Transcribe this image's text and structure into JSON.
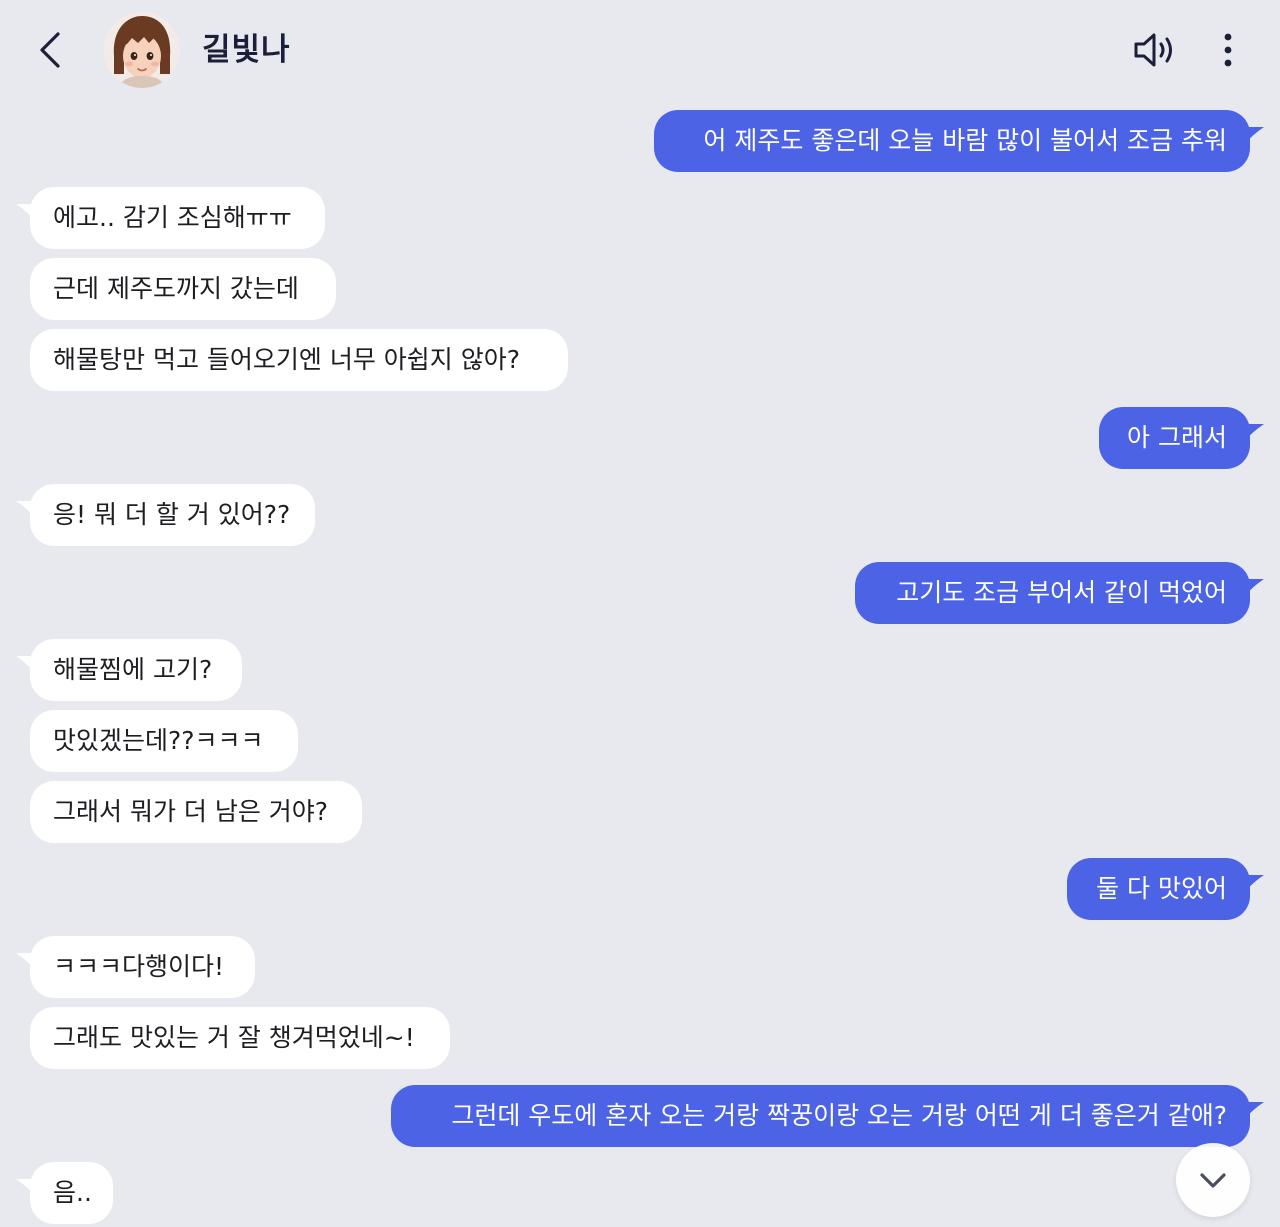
{
  "header": {
    "contact_name": "길빛나"
  },
  "colors": {
    "background": "#e8e9ee",
    "sent_bubble": "#4c63e6",
    "received_bubble": "#ffffff",
    "name_text": "#1c1f3a"
  },
  "icons": {
    "back": "chevron-left-icon",
    "speaker": "speaker-volume-icon",
    "more": "vertical-dots-icon",
    "scroll": "chevron-down-icon"
  },
  "messages": [
    {
      "side": "sent",
      "text": "어 제주도 좋은데 오늘 바람 많이 불어서 조금 추워"
    },
    {
      "side": "received",
      "text": "에고.. 감기 조심해ㅠㅠ"
    },
    {
      "side": "received",
      "text": "근데 제주도까지 갔는데"
    },
    {
      "side": "received",
      "text": "해물탕만 먹고 들어오기엔 너무 아쉽지 않아?"
    },
    {
      "side": "sent",
      "text": "아 그래서"
    },
    {
      "side": "received",
      "text": "응! 뭐 더 할 거 있어??"
    },
    {
      "side": "sent",
      "text": "고기도 조금 부어서 같이 먹었어"
    },
    {
      "side": "received",
      "text": "해물찜에 고기?"
    },
    {
      "side": "received",
      "text": "맛있겠는데??ㅋㅋㅋ"
    },
    {
      "side": "received",
      "text": "그래서 뭐가 더 남은 거야?"
    },
    {
      "side": "sent",
      "text": "둘 다 맛있어"
    },
    {
      "side": "received",
      "text": "ㅋㅋㅋ다행이다!"
    },
    {
      "side": "received",
      "text": "그래도 맛있는 거 잘 챙겨먹었네~!"
    },
    {
      "side": "sent",
      "text": "그런데 우도에 혼자 오는 거랑 짝꿍이랑 오는 거랑 어떤 게 더 좋은거 같애?"
    },
    {
      "side": "received",
      "text": "음.."
    }
  ]
}
